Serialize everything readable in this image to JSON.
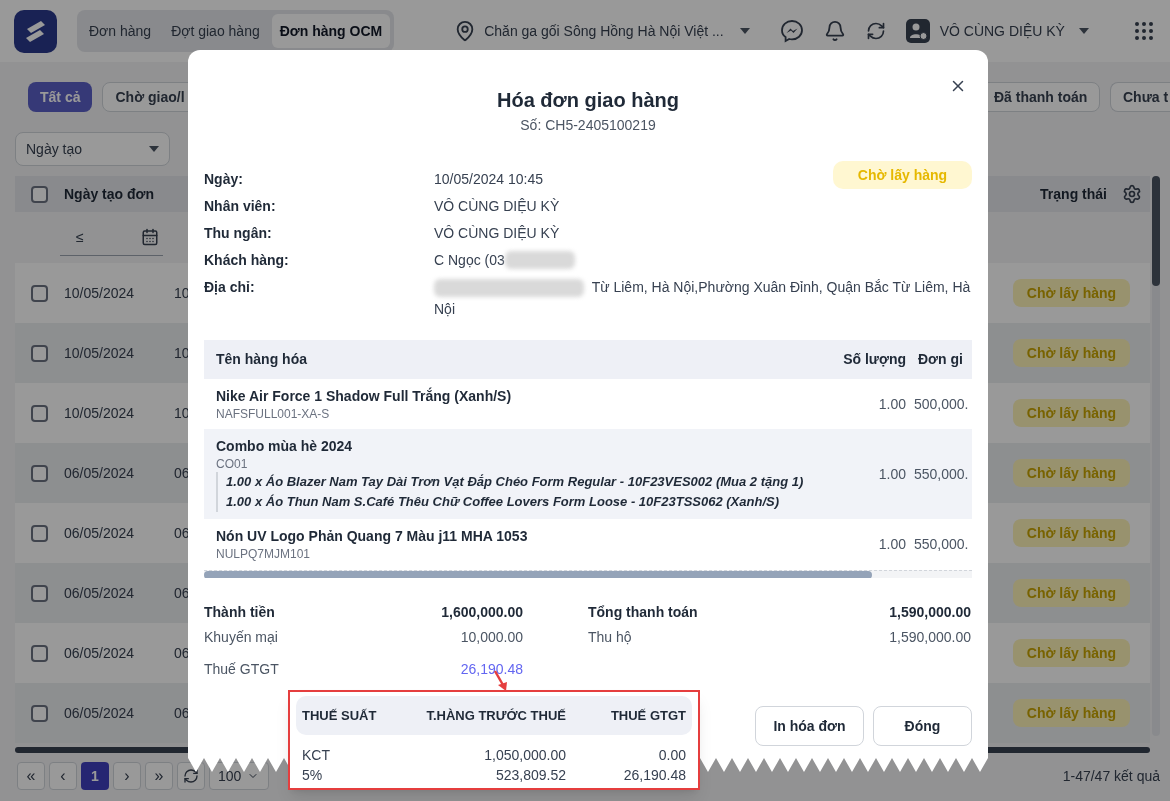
{
  "top_bar": {
    "tabs": [
      {
        "label": "Đơn hàng",
        "selected": false
      },
      {
        "label": "Đợt giao hàng",
        "selected": false
      },
      {
        "label": "Đơn hàng OCM",
        "selected": true
      }
    ],
    "store": "Chăn ga gối Sông Hồng Hà Nội Việt ...",
    "user": "VÔ CÙNG DIỆU KỲ"
  },
  "status_filters": [
    {
      "label": "Tất cả",
      "selected": true
    },
    {
      "label": "Chờ giao/l",
      "selected": false
    },
    {
      "label": "Đã thanh toán",
      "selected": false
    },
    {
      "label": "Chưa t",
      "selected": false
    }
  ],
  "date_filter": {
    "value": "Ngày tạo"
  },
  "table": {
    "columns": [
      "Ngày tạo đơn",
      "Trạng thái"
    ],
    "all_checked": false,
    "operator": "≤",
    "rows": [
      {
        "checked": false,
        "date": "10/05/2024",
        "column_3": "10",
        "status": "Chờ lấy hàng"
      },
      {
        "checked": false,
        "date": "10/05/2024",
        "column_3": "10",
        "status": "Chờ lấy hàng"
      },
      {
        "checked": false,
        "date": "10/05/2024",
        "column_3": "10",
        "status": "Chờ lấy hàng"
      },
      {
        "checked": false,
        "date": "06/05/2024",
        "column_3": "06",
        "status": "Chờ lấy hàng"
      },
      {
        "checked": false,
        "date": "06/05/2024",
        "column_3": "06",
        "status": "Chờ lấy hàng"
      },
      {
        "checked": false,
        "date": "06/05/2024",
        "column_3": "06",
        "status": "Chờ lấy hàng"
      },
      {
        "checked": false,
        "date": "06/05/2024",
        "column_3": "06",
        "status": "Chờ lấy hàng"
      },
      {
        "checked": false,
        "date": "06/05/2024",
        "column_3": "06",
        "status": "Chờ lấy hàng"
      }
    ]
  },
  "pagination": {
    "buttons": [
      {
        "kind": "nav",
        "label": "«",
        "selected": false
      },
      {
        "kind": "nav",
        "label": "‹",
        "selected": false
      },
      {
        "kind": "page",
        "label": "1",
        "selected": true
      },
      {
        "kind": "nav",
        "label": "›",
        "selected": false
      },
      {
        "kind": "nav",
        "label": "»",
        "selected": false
      }
    ],
    "page_size": "100",
    "summary": "1-47/47 kết quả"
  },
  "invoice": {
    "title": "Hóa đơn giao hàng",
    "number": "Số: CH5-2405100219",
    "status": "Chờ lấy hàng",
    "fields": [
      {
        "label": "Ngày:",
        "value": "10/05/2024 10:45"
      },
      {
        "label": "Nhân viên:",
        "value": "VÔ CÙNG DIỆU KỲ"
      },
      {
        "label": "Thu ngân:",
        "value": "VÔ CÙNG DIỆU KỲ"
      },
      {
        "label": "Khách hàng:",
        "value": "C Ngọc (03",
        "redacted_suffix": true
      },
      {
        "label": "Địa chỉ:",
        "value": "Từ Liêm, Hà Nội,Phường Xuân Đỉnh, Quận Bắc Từ Liêm, Hà Nội",
        "redacted_prefix": true
      }
    ],
    "columns": [
      "Tên hàng hóa",
      "Số lượng",
      "Đơn gi"
    ],
    "items": [
      {
        "name": "Nike Air Force 1 Shadow Full Trắng (Xanh/S)",
        "sku": "NAFSFULL001-XA-S",
        "quantity": "1.00",
        "price": "500,000.",
        "striped": false
      },
      {
        "name": "Combo mùa hè 2024",
        "sku": "CO01",
        "quantity": "1.00",
        "price": "550,000.",
        "striped": true,
        "components": [
          "1.00 x Áo Blazer Nam Tay Dài Trơn Vạt Đắp Chéo Form Regular - 10F23VES002 (Mua 2 tặng 1)",
          "1.00 x Áo Thun Nam S.Café Thêu Chữ Coffee Lovers Form Loose - 10F23TSS062 (Xanh/S)"
        ]
      },
      {
        "name": "Nón UV Logo Phản Quang 7 Màu j11 MHA 1053",
        "sku": "NULPQ7MJM101",
        "quantity": "1.00",
        "price": "550,000.",
        "striped": false
      }
    ],
    "scroll": {
      "level": 0.87
    },
    "totals_left": [
      {
        "kind": "total",
        "label": "Thành tiền",
        "value": "1,600,000.00"
      },
      {
        "kind": "plain",
        "label": "Khuyến mại",
        "value": "10,000.00"
      },
      {
        "kind": "link",
        "label": "Thuế GTGT",
        "value": "26,190.48"
      }
    ],
    "totals_right": [
      {
        "kind": "total",
        "label": "Tổng thanh toán",
        "value": "1,590,000.00"
      },
      {
        "kind": "plain",
        "label": "Thu hộ",
        "value": "1,590,000.00"
      }
    ],
    "buttons": [
      "In hóa đơn",
      "Đóng"
    ]
  },
  "vat_popover": {
    "columns": [
      "THUẾ SUẤT",
      "T.HÀNG TRƯỚC THUẾ",
      "THUẾ GTGT"
    ],
    "rows": [
      [
        "KCT",
        "1,050,000.00",
        "0.00"
      ],
      [
        "5%",
        "523,809.52",
        "26,190.48"
      ]
    ]
  }
}
